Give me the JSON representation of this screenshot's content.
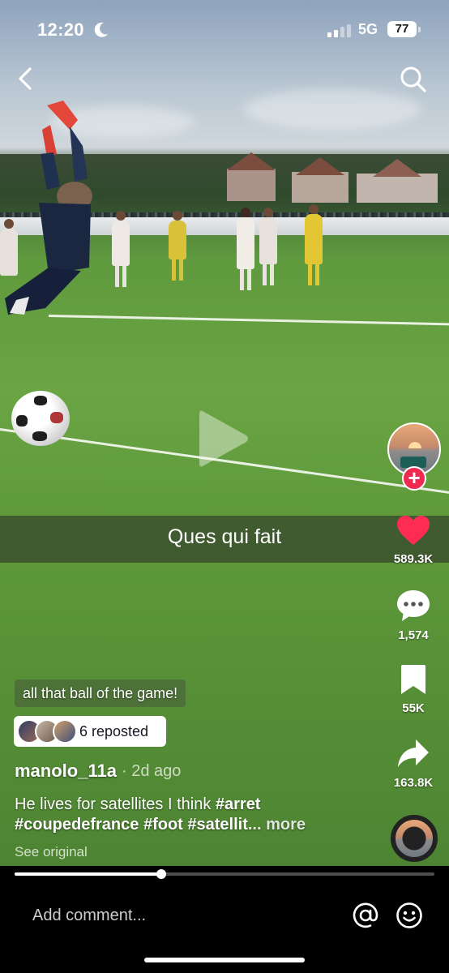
{
  "status_bar": {
    "time": "12:20",
    "network": "5G",
    "battery": "77"
  },
  "video": {
    "subtitle": "Ques qui fait",
    "progress_fraction": 0.35
  },
  "actions": {
    "likes": "589.3K",
    "comments": "1,574",
    "saves": "55K",
    "shares": "163.8K"
  },
  "post": {
    "caption_chip": "all that ball of the game!",
    "repost_text": "6 reposted",
    "username": "manolo_11a",
    "date": "· 2d ago",
    "description_text": "He lives for satellites I think ",
    "hashtags": "#arret #coupedefrance #foot #satellit",
    "more_label": "... more",
    "see_original": "See original"
  },
  "comment_bar": {
    "placeholder": "Add comment..."
  },
  "icons": {
    "back": "chevron-left-icon",
    "search": "search-icon",
    "play": "play-icon",
    "like": "heart-icon",
    "comment": "speech-bubble-icon",
    "save": "bookmark-icon",
    "share": "share-arrow-icon",
    "at": "at-icon",
    "emoji": "smiley-icon"
  },
  "colors": {
    "like_red": "#fe2c55",
    "follow_red": "#ef2950",
    "pitch_green": "#5f9a3e"
  }
}
